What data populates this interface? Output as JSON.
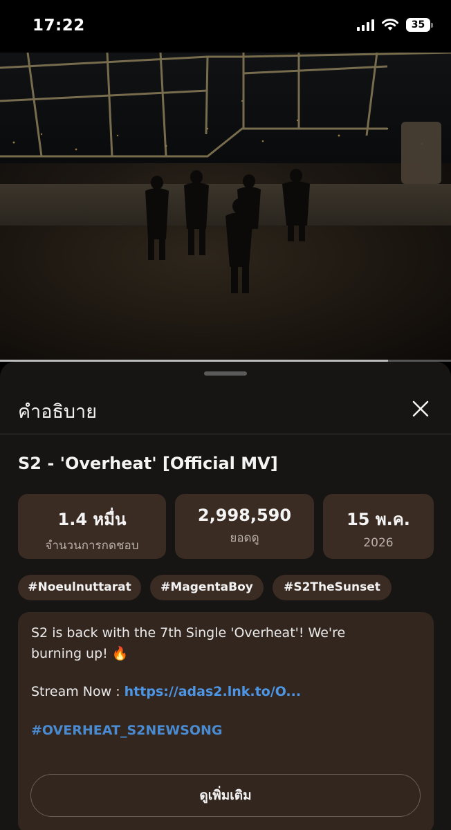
{
  "status_bar": {
    "time": "17:22",
    "battery": "35"
  },
  "video": {
    "progress_fraction": 0.86
  },
  "sheet": {
    "title": "คำอธิบาย",
    "video_title": "S2 - 'Overheat' [Official MV]",
    "stats": [
      {
        "value": "1.4 หมื่น",
        "label": "จำนวนการกดชอบ"
      },
      {
        "value": "2,998,590",
        "label": "ยอดดู"
      },
      {
        "value": "15 พ.ค.",
        "label": "2026"
      }
    ],
    "tags": [
      "#Noeulnuttarat",
      "#MagentaBoy",
      "#S2TheSunset"
    ],
    "description": {
      "line1": "S2 is back with the 7th Single 'Overheat'! We're",
      "line2": "burning up! 🔥",
      "stream_prefix": "Stream Now : ",
      "stream_link": "https://adas2.lnk.to/O...",
      "hashtag": "#OVERHEAT_S2NEWSONG",
      "more_label": "ดูเพิ่มเติม"
    }
  },
  "icons": {
    "close": "close-icon",
    "wifi": "wifi-icon",
    "signal": "signal-icon",
    "battery": "battery-icon"
  },
  "colors": {
    "link": "#4d96e6",
    "card": "#3a2b23",
    "sheet": "#161514"
  }
}
